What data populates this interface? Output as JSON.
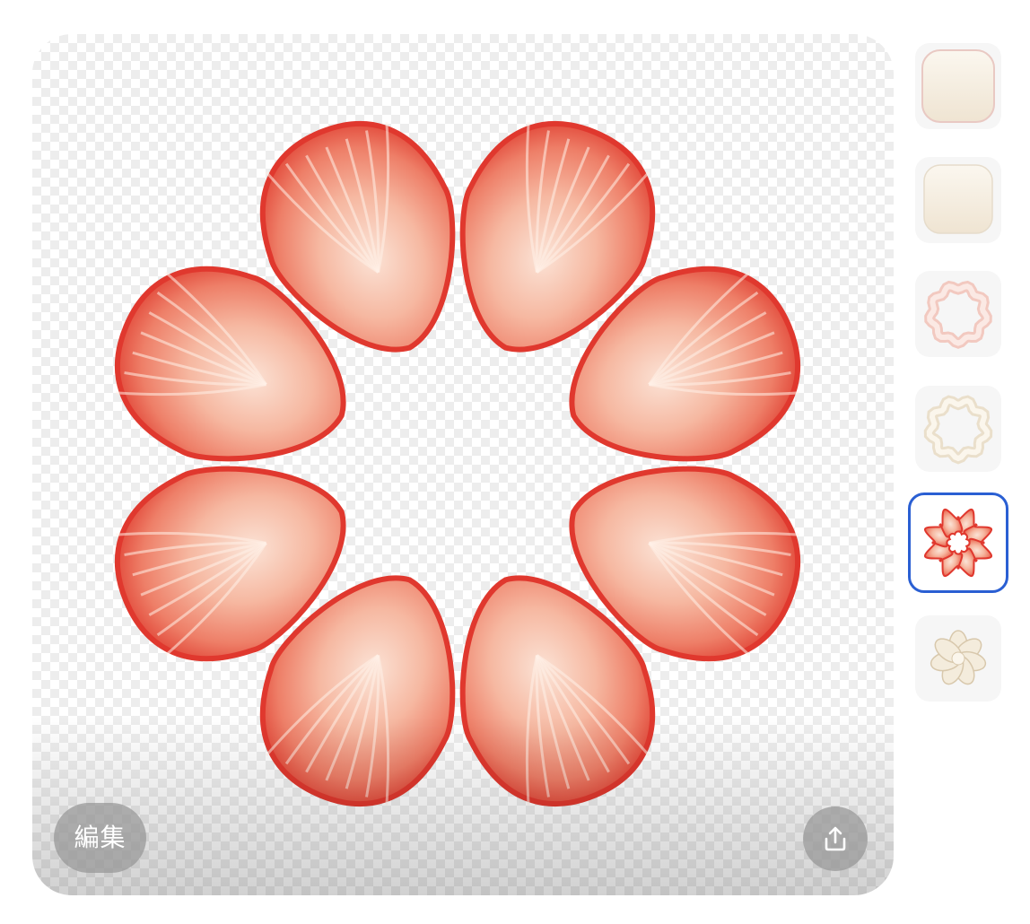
{
  "canvas": {
    "edit_label": "編集",
    "share_icon": "share-upload-icon",
    "subject": "strawberry-slice-flower"
  },
  "sidebar": {
    "items": [
      {
        "name": "thumb-cream-square-rounded",
        "icon": "cream-square-icon",
        "selected": false
      },
      {
        "name": "thumb-cream-square-soft",
        "icon": "cream-square-icon",
        "selected": false
      },
      {
        "name": "thumb-pink-ring",
        "icon": "pink-ring-icon",
        "selected": false
      },
      {
        "name": "thumb-cream-ring",
        "icon": "cream-ring-icon",
        "selected": false
      },
      {
        "name": "thumb-strawberry-flower",
        "icon": "strawberry-flower-icon",
        "selected": true
      },
      {
        "name": "thumb-whipped-cream",
        "icon": "whipped-cream-icon",
        "selected": false
      }
    ]
  },
  "colors": {
    "selection_border": "#2a5fd3",
    "strawberry_red": "#e0382e",
    "strawberry_flesh": "#f7b5a0",
    "cream": "#f6efe2"
  }
}
